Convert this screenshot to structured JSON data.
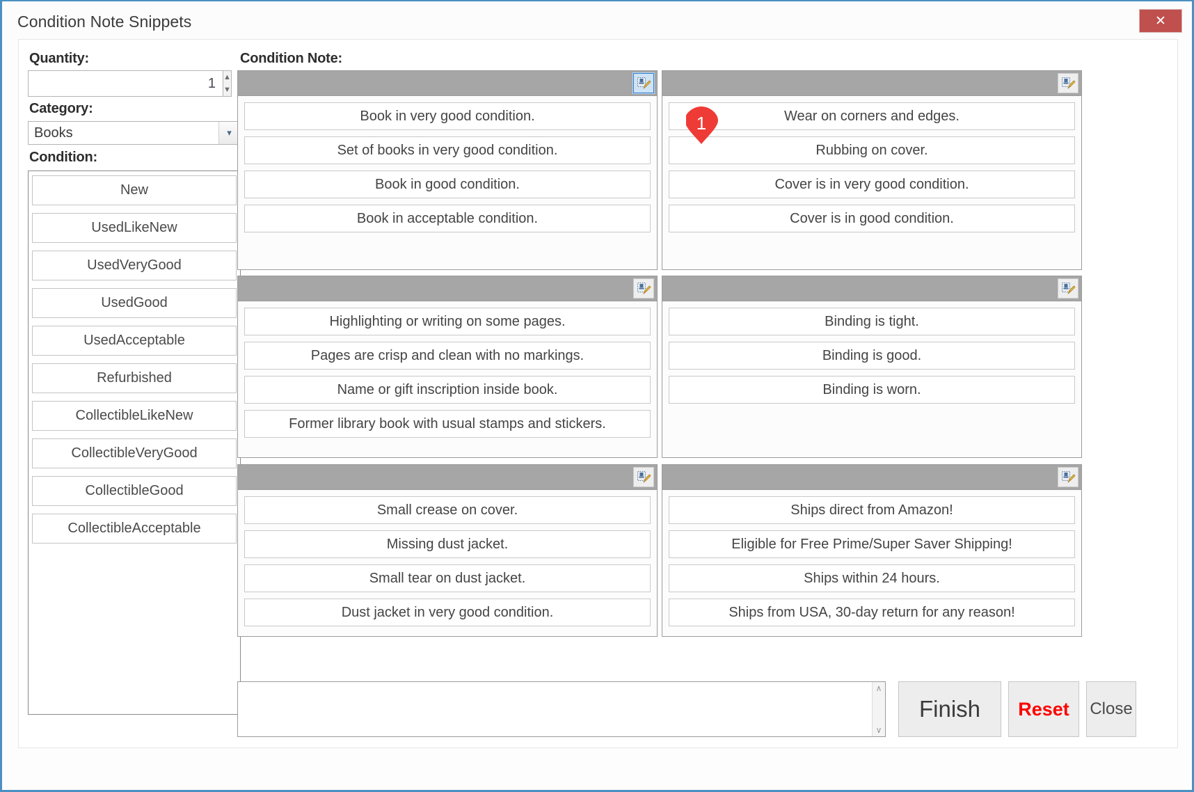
{
  "window": {
    "title": "Condition Note Snippets",
    "close_label": "✕"
  },
  "left": {
    "quantity_label": "Quantity:",
    "quantity_value": "1",
    "spinner_up": "▲",
    "spinner_down": "▼",
    "category_label": "Category:",
    "category_value": "Books",
    "category_arrow": "⌄",
    "condition_label": "Condition:",
    "conditions": [
      "New",
      "UsedLikeNew",
      "UsedVeryGood",
      "UsedGood",
      "UsedAcceptable",
      "Refurbished",
      "CollectibleLikeNew",
      "CollectibleVeryGood",
      "CollectibleGood",
      "CollectibleAcceptable"
    ]
  },
  "main": {
    "notes_label": "Condition Note:",
    "badge_number": "1",
    "badge_color": "#ef3b36",
    "edit_icon_name": "edit-snippets-icon",
    "panels": [
      {
        "id": "panel-condition-overall",
        "edit_icon_selected": true,
        "snippets": [
          "Book in very good condition.",
          "Set of books in very good condition.",
          "Book in good condition.",
          "Book in acceptable condition."
        ]
      },
      {
        "id": "panel-cover",
        "edit_icon_selected": false,
        "snippets": [
          "Wear on corners and edges.",
          "Rubbing on cover.",
          "Cover is in very good condition.",
          "Cover is in good condition."
        ]
      },
      {
        "id": "panel-pages",
        "edit_icon_selected": false,
        "snippets": [
          "Highlighting or writing on some pages.",
          "Pages are crisp and clean with no markings.",
          "Name or gift inscription inside book.",
          "Former library book with usual stamps and stickers."
        ]
      },
      {
        "id": "panel-binding",
        "edit_icon_selected": false,
        "snippets": [
          "Binding is tight.",
          "Binding is good.",
          "Binding is worn."
        ]
      },
      {
        "id": "panel-dust-jacket",
        "edit_icon_selected": false,
        "snippets": [
          "Small crease on cover.",
          "Missing dust jacket.",
          "Small tear on dust jacket.",
          "Dust jacket in very good condition."
        ]
      },
      {
        "id": "panel-shipping",
        "edit_icon_selected": false,
        "snippets": [
          "Ships direct from Amazon!",
          "Eligible for Free Prime/Super Saver Shipping!",
          "Ships within 24 hours.",
          "Ships from USA, 30-day return for any reason!"
        ]
      }
    ]
  },
  "footer": {
    "note_value": "",
    "note_placeholder": "",
    "scroll_up": "∧",
    "scroll_down": "∨",
    "finish_label": "Finish",
    "reset_label": "Reset",
    "close_label": "Close"
  }
}
